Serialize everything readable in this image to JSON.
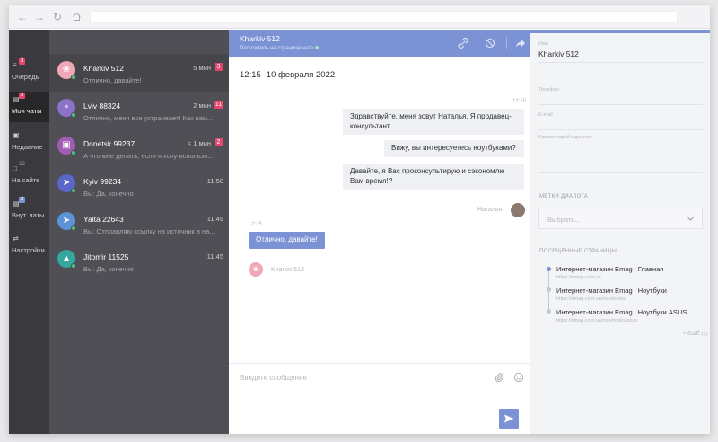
{
  "nav": [
    {
      "label": "Очередь",
      "badge": "3",
      "icon": "queue-icon"
    },
    {
      "label": "Мои чаты",
      "badge": "3",
      "icon": "my-chats-icon"
    },
    {
      "label": "Недавние",
      "badge": "",
      "icon": "recent-icon"
    },
    {
      "label": "На сайте",
      "badge": "12",
      "icon": "on-site-icon"
    },
    {
      "label": "Внут. чаты",
      "badge": "2",
      "icon": "internal-chats-icon"
    },
    {
      "label": "Настройки",
      "badge": "",
      "icon": "settings-icon"
    }
  ],
  "chats": [
    {
      "name": "Kharkiv 512",
      "preview": "Отлично, давайте!",
      "time": "5 мин",
      "badge": "3",
      "color": "#f0a7b6"
    },
    {
      "name": "Lviv 88324",
      "preview": "Отлично, меня все устраивает! Как нам...",
      "time": "2 мин",
      "badge": "11",
      "color": "#8d72c9"
    },
    {
      "name": "Donetsk 99237",
      "preview": "А что мне делать, если я хочу использо...",
      "time": "< 1 мин",
      "badge": "2",
      "color": "#a25cb5"
    },
    {
      "name": "Kyiv 99234",
      "preview": "Вы: Да, конечно",
      "time": "11:50",
      "badge": "",
      "color": "#5a67c8"
    },
    {
      "name": "Yalta 22643",
      "preview": "Вы: Отправляю ссылку на источник в на...",
      "time": "11:49",
      "badge": "",
      "color": "#5b93d6"
    },
    {
      "name": "Jitomir 11525",
      "preview": "Вы: Да, конечно",
      "time": "11:45",
      "badge": "",
      "color": "#34a89f"
    }
  ],
  "conversation": {
    "title": "Kharkiv 512",
    "subtitle": "Посетитель на странице чата",
    "date_time": "12:15",
    "date": "10 февраля 2022",
    "agent_time": "12:15",
    "messages_out": [
      "Здравствуйте, меня зовут Наталья. Я продавец-консультант.",
      "Вижу, вы интересуетесь ноутбуками?",
      "Давайте, я Вас проконсультирую и сэкономлю Вам время!?"
    ],
    "agent_name": "Наталья",
    "client_time": "12:15",
    "message_in": "Отлично, давайте!",
    "typing_name": "Kharkiv 512",
    "input_placeholder": "Введите сообщение"
  },
  "details": {
    "name_label": "Имя",
    "name_value": "Kharkiv 512",
    "phone_label": "Телефон",
    "email_label": "E-mail",
    "comment_label": "Комментарий к диалогу",
    "tags_title": "МЕТКИ ДИАЛОГА",
    "tags_placeholder": "Выбрать...",
    "pages_title": "ПОСЕЩЕННЫЕ СТРАНИЦЫ",
    "pages": [
      {
        "title": "Интернет-магазин Emag | Главная",
        "url": "https://emag.com.ua"
      },
      {
        "title": "Интернет-магазин Emag | Ноутбуки",
        "url": "https://emag.com.ua/notebooks/"
      },
      {
        "title": "Интернет-магазин Emag | Ноутбуки ASUS",
        "url": "https://emag.com.ua/notebooks/asus"
      }
    ],
    "more": "+ ЕЩЁ (2)"
  },
  "colors": {
    "accent": "#7b93d4",
    "badge": "#e5466b",
    "online": "#43c77a"
  }
}
